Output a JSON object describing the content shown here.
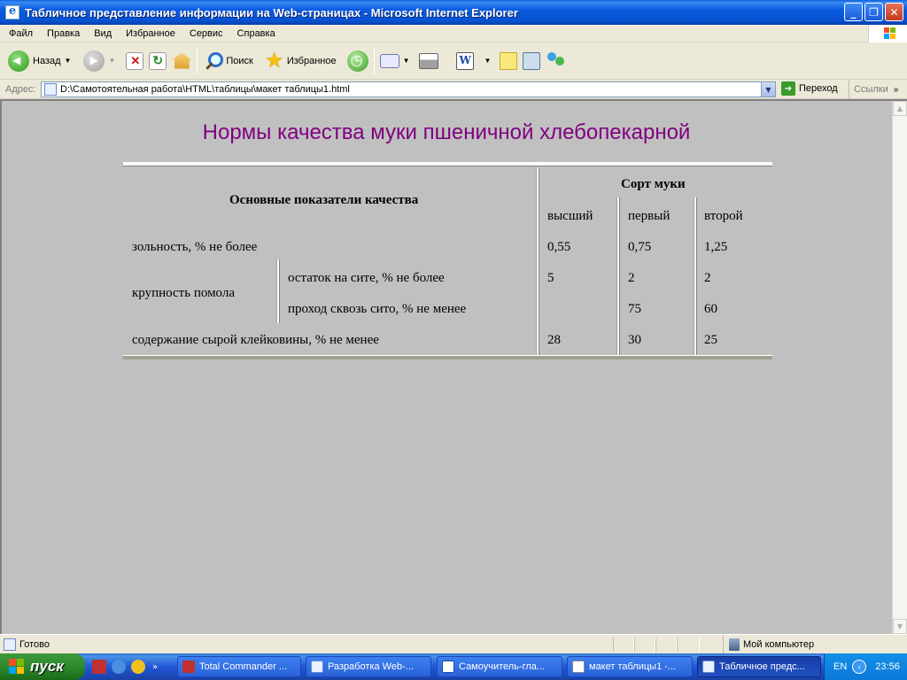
{
  "window": {
    "title": "Табличное представление информации на Web-страницах - Microsoft Internet Explorer",
    "minimize_icon": "minimize-icon",
    "maximize_icon": "restore-icon",
    "close_icon": "close-icon"
  },
  "menu": {
    "items": [
      "Файл",
      "Правка",
      "Вид",
      "Избранное",
      "Сервис",
      "Справка"
    ]
  },
  "toolbar": {
    "back_label": "Назад",
    "search_label": "Поиск",
    "favorites_label": "Избранное"
  },
  "address": {
    "label": "Адрес:",
    "value": "D:\\Самотоятельная работа\\HTML\\таблицы\\макет таблицы1.html",
    "go_label": "Переход",
    "links_label": "Ссылки"
  },
  "page": {
    "title": "Нормы качества муки пшеничной хлебопекарной",
    "title_color": "#800080",
    "background": "#c0c0c0",
    "table": {
      "header_main": "Основные показатели качества",
      "header_group": "Сорт муки",
      "grades": [
        "высший",
        "первый",
        "второй"
      ],
      "rows": {
        "ash": {
          "label": "зольность, % не более",
          "values": [
            "0,55",
            "0,75",
            "1,25"
          ]
        },
        "grind": {
          "label": "крупность помола",
          "sub1": {
            "label": "остаток на сите, % не более",
            "values": [
              "5",
              "2",
              "2"
            ]
          },
          "sub2": {
            "label": "проход сквозь сито, % не менее",
            "values": [
              "",
              "75",
              "60"
            ]
          }
        },
        "gluten": {
          "label": "содержание сырой клейковины, % не менее",
          "values": [
            "28",
            "30",
            "25"
          ]
        }
      }
    }
  },
  "status": {
    "text": "Готово",
    "zone": "Мой компьютер"
  },
  "taskbar": {
    "start_label": "пуск",
    "tasks": [
      "Total Commander ...",
      "Разработка Web-...",
      "Самоучитель-гла...",
      "макет таблицы1 -...",
      "Табличное предс..."
    ],
    "lang": "EN",
    "clock": "23:56"
  }
}
